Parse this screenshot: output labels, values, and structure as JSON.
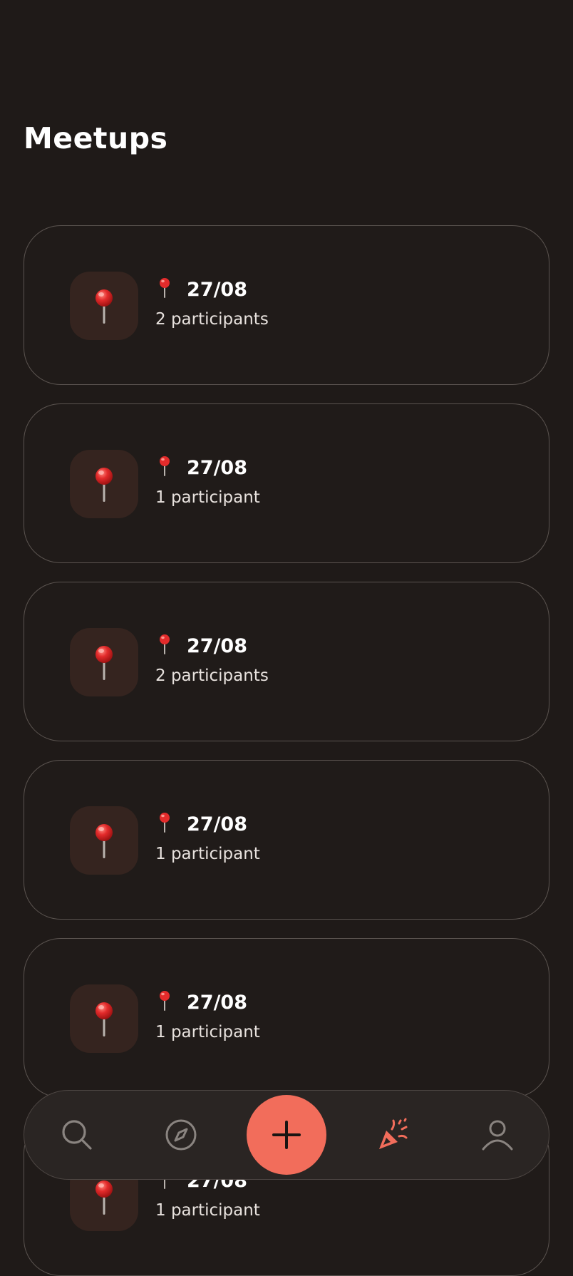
{
  "header": {
    "title": "Meetups"
  },
  "meetups": [
    {
      "date": "27/08",
      "participants": "2 participants",
      "icon": "round-pushpin-icon"
    },
    {
      "date": "27/08",
      "participants": "1 participant",
      "icon": "round-pushpin-icon"
    },
    {
      "date": "27/08",
      "participants": "2 participants",
      "icon": "round-pushpin-icon"
    },
    {
      "date": "27/08",
      "participants": "1 participant",
      "icon": "round-pushpin-icon"
    },
    {
      "date": "27/08",
      "participants": "1 participant",
      "icon": "round-pushpin-icon"
    },
    {
      "date": "27/08",
      "participants": "1 participant",
      "icon": "round-pushpin-icon"
    }
  ],
  "bottom_nav": {
    "items": [
      {
        "icon": "search-icon",
        "active": false
      },
      {
        "icon": "compass-icon",
        "active": false
      },
      {
        "icon": "plus-icon",
        "active": false
      },
      {
        "icon": "party-popper-icon",
        "active": true
      },
      {
        "icon": "user-icon",
        "active": false
      }
    ]
  },
  "colors": {
    "background": "#1f1a18",
    "card_border": "#5b5450",
    "icon_tile": "#35241f",
    "accent": "#f26d5b",
    "nav_inactive": "#8a8480",
    "text_primary": "#ffffff",
    "text_secondary": "#e8e2de"
  }
}
